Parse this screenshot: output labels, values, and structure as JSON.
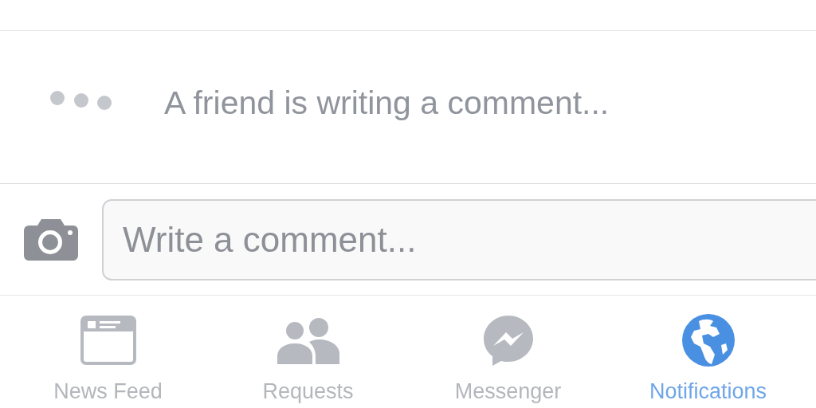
{
  "typing_indicator": {
    "text": "A friend is writing a comment..."
  },
  "comment_bar": {
    "placeholder": "Write a comment..."
  },
  "tab_bar": [
    {
      "kind": "news_feed",
      "label": "News Feed",
      "selected": false
    },
    {
      "kind": "requests",
      "label": "Requests",
      "selected": false
    },
    {
      "kind": "messenger",
      "label": "Messenger",
      "selected": false
    },
    {
      "kind": "notifications",
      "label": "Notifications",
      "selected": true
    }
  ]
}
